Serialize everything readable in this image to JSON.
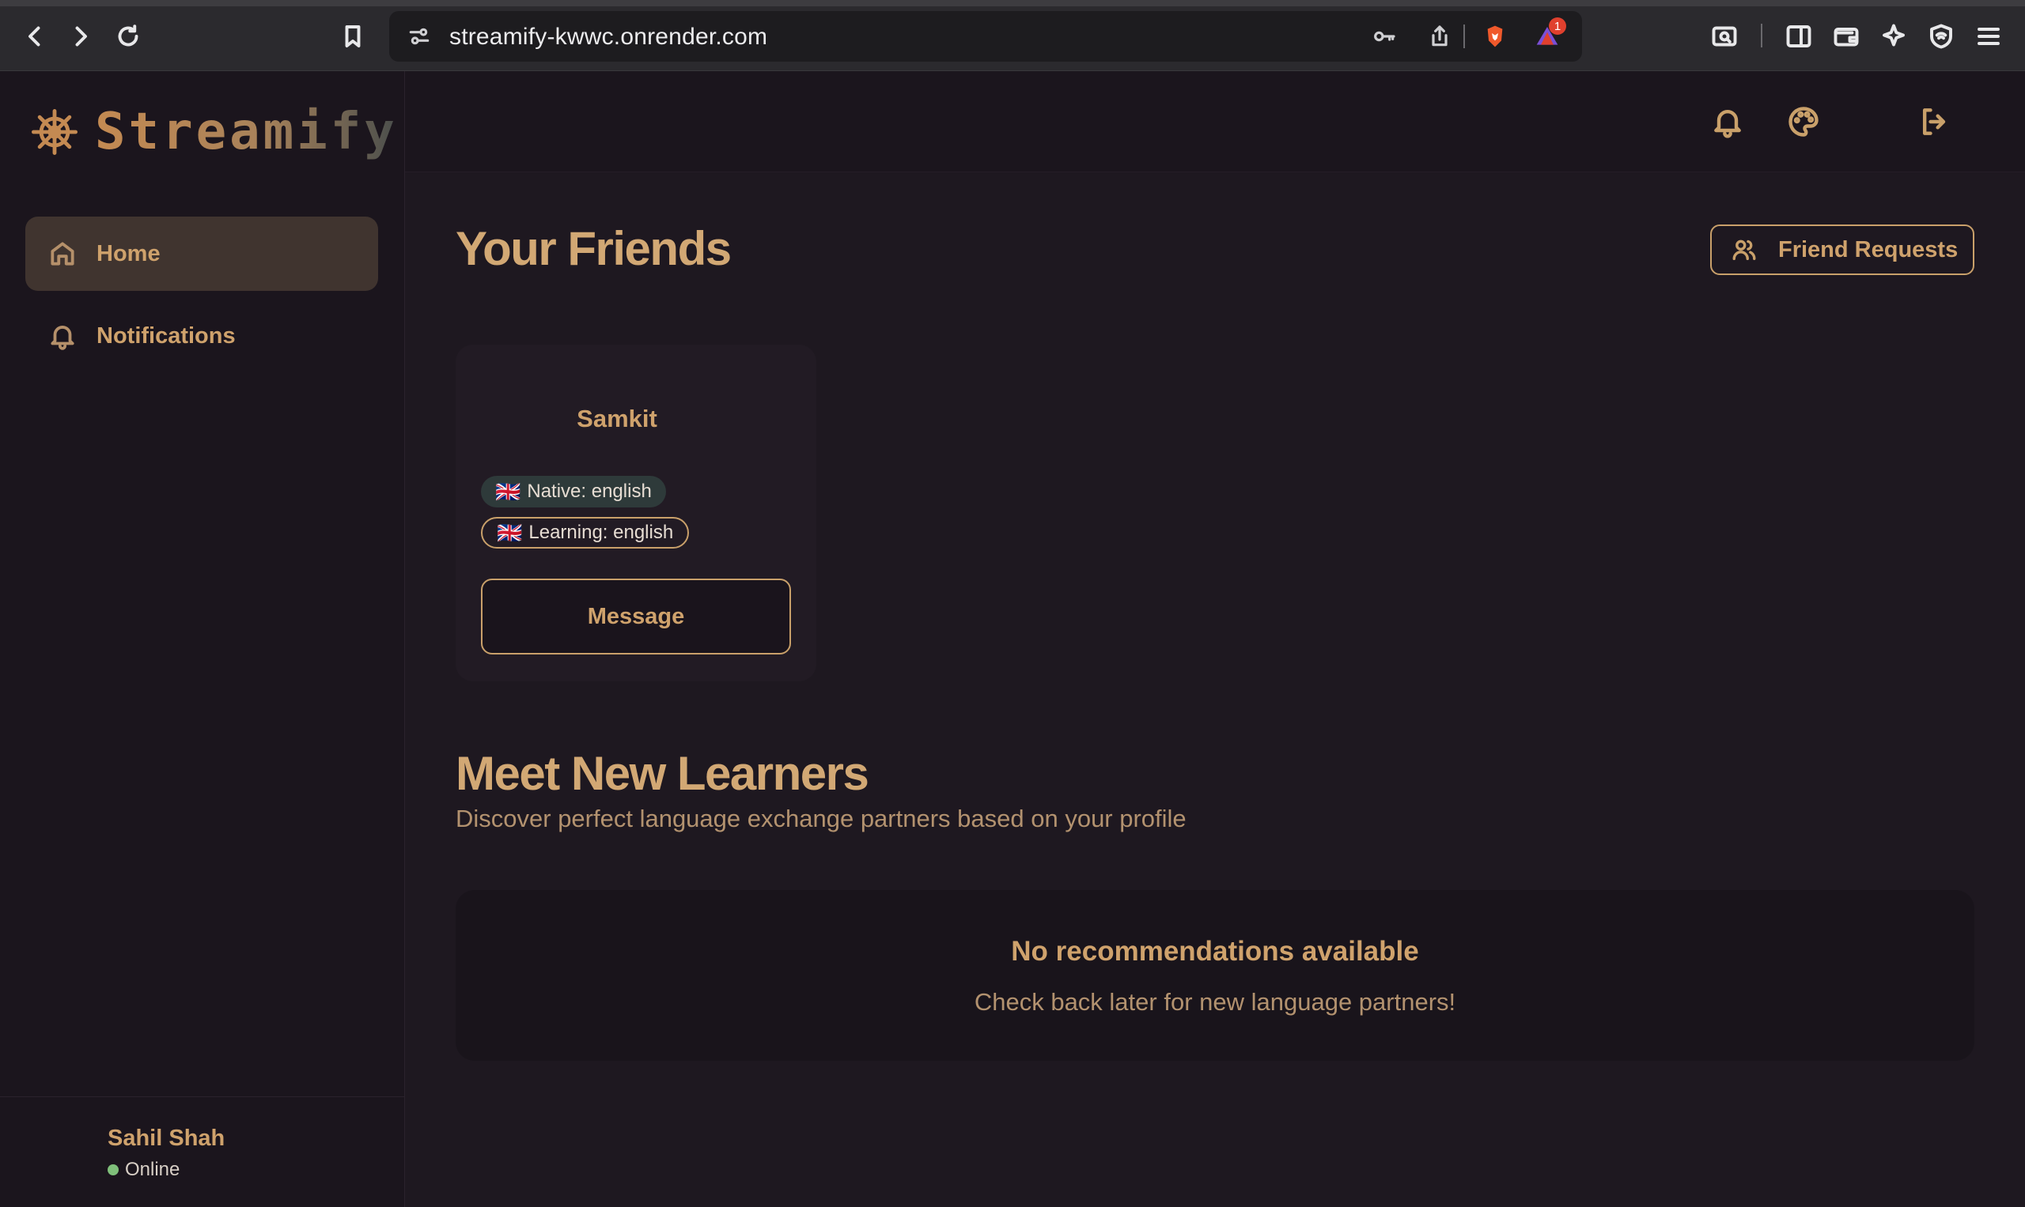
{
  "browser": {
    "url": "streamify-kwwc.onrender.com",
    "notification_badge": "1"
  },
  "brand": {
    "name": "Streamify",
    "gradient_colors": [
      "#c48a52",
      "#4a4e4c"
    ]
  },
  "sidebar": {
    "items": [
      {
        "label": "Home",
        "icon": "home-icon",
        "active": true
      },
      {
        "label": "Notifications",
        "icon": "bell-icon",
        "active": false
      }
    ],
    "user": {
      "name": "Sahil Shah",
      "status": "Online"
    }
  },
  "topbar": {
    "icons": [
      "bell-icon",
      "palette-icon",
      "logout-icon"
    ]
  },
  "main": {
    "friends_title": "Your Friends",
    "friend_requests_label": "Friend Requests",
    "friends": [
      {
        "name": "Samkit",
        "native": "Native: english",
        "learning": "Learning: english",
        "flag": "🇬🇧",
        "message_label": "Message"
      }
    ],
    "learners_title": "Meet New Learners",
    "learners_subtitle": "Discover perfect language exchange partners based on your profile",
    "empty_title": "No recommendations available",
    "empty_text": "Check back later for new language partners!"
  },
  "colors": {
    "accent": "#c9a06a",
    "background": "#1e1820",
    "sidebar_bg": "#1b151d",
    "active_item_bg": "#40342f",
    "online": "#7fbf7a"
  }
}
